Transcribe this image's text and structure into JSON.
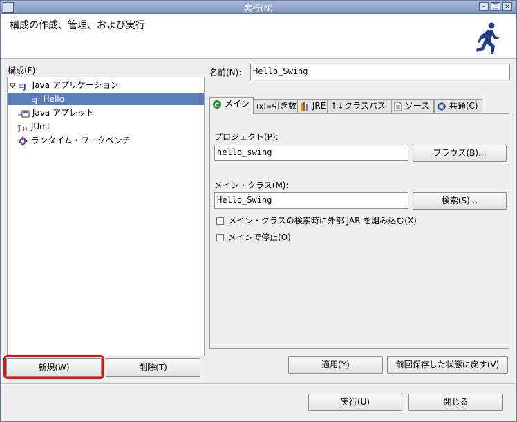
{
  "window": {
    "title": "実行(N)"
  },
  "header": {
    "message": "構成の作成、管理、および実行"
  },
  "left": {
    "config_label": "構成(F):",
    "tree": [
      {
        "label": "Java アプリケーション",
        "expanded": true
      },
      {
        "label": "Hello",
        "selected": true
      },
      {
        "label": "Java アプレット"
      },
      {
        "label": "JUnit"
      },
      {
        "label": "ランタイム・ワークベンチ"
      }
    ],
    "new_button": "新規(W)",
    "delete_button": "削除(T)"
  },
  "right": {
    "name_label": "名前(N):",
    "name_value": "Hello_Swing",
    "tabs": [
      {
        "label": "メイン",
        "icon": "main-tab-icon"
      },
      {
        "label": "引き数",
        "icon": "arguments-tab-icon",
        "prefix": "(x)="
      },
      {
        "label": "JRE",
        "icon": "jre-tab-icon"
      },
      {
        "label": "クラスパス",
        "icon": "classpath-tab-icon",
        "prefix": "↑↓"
      },
      {
        "label": "ソース",
        "icon": "source-tab-icon"
      },
      {
        "label": "共通(C)",
        "icon": "common-tab-icon"
      }
    ],
    "project_label": "プロジェクト(P):",
    "project_value": "hello_swing",
    "browse_button": "ブラウズ(B)...",
    "main_class_label": "メイン・クラス(M):",
    "main_class_value": "Hello_Swing",
    "search_button": "検索(S)...",
    "include_external_jars": "メイン・クラスの検索時に外部 JAR を組み込む(X)",
    "stop_in_main": "メインで停止(O)",
    "apply_button": "適用(Y)",
    "revert_button": "前回保存した状態に戻す(V)"
  },
  "footer": {
    "run_button": "実行(U)",
    "close_button": "閉じる"
  },
  "colors": {
    "selection": "#5c7bb9",
    "highlight_box": "#e21414",
    "titlebar": "#8ba1c9"
  }
}
